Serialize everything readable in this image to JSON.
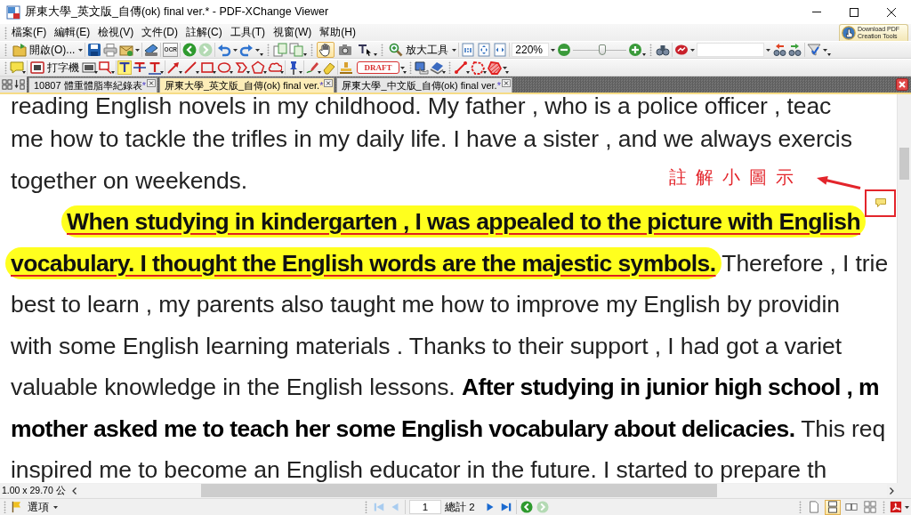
{
  "window": {
    "title": "屏東大學_英文版_自傳(ok) final ver.* - PDF-XChange Viewer"
  },
  "menu": [
    "檔案(F)",
    "編輯(E)",
    "檢視(V)",
    "文件(D)",
    "註解(C)",
    "工具(T)",
    "視窗(W)",
    "幫助(H)"
  ],
  "promo": {
    "label": "Download PDF Creation Tools"
  },
  "toolbar_main": {
    "open_label": "開啟(O)...",
    "ocr_label": "OCR",
    "history": [
      {
        "kind": "back",
        "disabled": false
      },
      {
        "kind": "forward",
        "disabled": true
      }
    ],
    "tools": [
      {
        "kind": "hand",
        "selected": true
      },
      {
        "kind": "snapshot",
        "selected": false
      },
      {
        "kind": "text-select",
        "selected": false
      }
    ],
    "zoom_tool_label": "放大工具",
    "zoom_value": "220%",
    "zoom_slider": {
      "level": 0.55
    }
  },
  "toolbar_comment": {
    "typewriter_label": "打字機",
    "stamp_label": "DRAFT"
  },
  "tabs": [
    {
      "label": "10807 體重體脂率紀錄表",
      "mark": "*",
      "selected": false
    },
    {
      "label": "屏東大學_英文版_自傳(ok) final ver.",
      "mark": "*",
      "selected": true
    },
    {
      "label": "屏東大學_中文版_自傳(ok) final ver.",
      "mark": "*",
      "selected": false
    }
  ],
  "document": {
    "lines": [
      {
        "indent": false,
        "segments": [
          {
            "kind": "plain",
            "text": "reading English novels in my childhood. My father , who is a police officer , teac"
          }
        ]
      },
      {
        "indent": false,
        "segments": [
          {
            "kind": "plain",
            "text": "me how to tackle the trifles in my daily life. I have a sister , and we always exercis"
          }
        ]
      },
      {
        "indent": false,
        "segments": [
          {
            "kind": "plain",
            "text": "together on weekends."
          }
        ]
      },
      {
        "indent": true,
        "segments": [
          {
            "kind": "highlight",
            "text": "When studying in kindergarten , I was appealed to the picture with English"
          }
        ]
      },
      {
        "indent": false,
        "segments": [
          {
            "kind": "highlight",
            "text": "vocabulary. I thought the English words are the majestic symbols."
          },
          {
            "kind": "plain",
            "text": " Therefore , I trie"
          }
        ]
      },
      {
        "indent": false,
        "segments": [
          {
            "kind": "plain",
            "text": "best to learn , my parents also taught me how to improve my English by providin"
          }
        ]
      },
      {
        "indent": false,
        "segments": [
          {
            "kind": "plain",
            "text": "with some English learning materials . Thanks to their support , I had got a variet"
          }
        ]
      },
      {
        "indent": false,
        "segments": [
          {
            "kind": "plain",
            "text": "valuable knowledge in the English lessons. "
          },
          {
            "kind": "bold",
            "text": "After studying in junior high school , m"
          }
        ]
      },
      {
        "indent": false,
        "segments": [
          {
            "kind": "bold",
            "text": "mother asked me to teach her some English vocabulary about delicacies."
          },
          {
            "kind": "plain",
            "text": " This req"
          }
        ]
      },
      {
        "indent": false,
        "segments": [
          {
            "kind": "plain",
            "text": "inspired me to become an English educator in the future. I started to prepare th"
          }
        ]
      }
    ]
  },
  "callout": {
    "label": "註解小圖示"
  },
  "page_size": "1.00 x 29.70 公",
  "status_bar": {
    "options_label": "選項",
    "nav_before": [
      {
        "kind": "first",
        "disabled": true
      },
      {
        "kind": "prev",
        "disabled": true
      }
    ],
    "page": "1",
    "total": "總計 2",
    "nav_after": [
      {
        "kind": "next",
        "disabled": false
      },
      {
        "kind": "last",
        "disabled": false
      }
    ],
    "history": [
      {
        "kind": "back",
        "disabled": false
      },
      {
        "kind": "forward",
        "disabled": true
      }
    ],
    "views": [
      {
        "kind": "single",
        "selected": false
      },
      {
        "kind": "continuous",
        "selected": true
      },
      {
        "kind": "facing",
        "selected": false
      },
      {
        "kind": "facing-continuous",
        "selected": false
      }
    ]
  }
}
